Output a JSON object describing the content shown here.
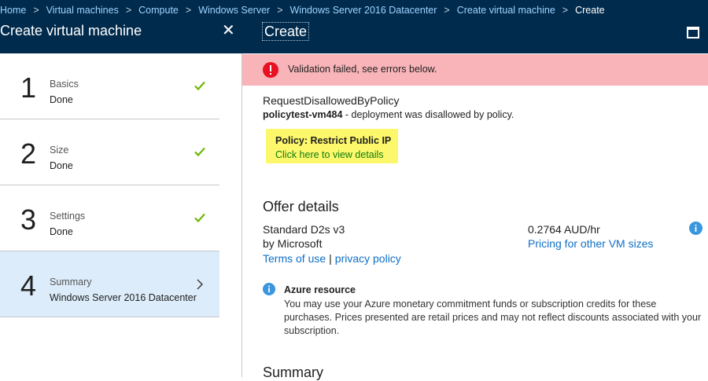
{
  "breadcrumb": [
    "Home",
    "Virtual machines",
    "Compute",
    "Windows Server",
    "Windows Server 2016 Datacenter",
    "Create virtual machine",
    "Create"
  ],
  "left_panel": {
    "title": "Create virtual machine",
    "close_icon": "close-icon",
    "steps": [
      {
        "number": "1",
        "label": "Basics",
        "status": "Done",
        "state": "complete"
      },
      {
        "number": "2",
        "label": "Size",
        "status": "Done",
        "state": "complete"
      },
      {
        "number": "3",
        "label": "Settings",
        "status": "Done",
        "state": "complete"
      },
      {
        "number": "4",
        "label": "Summary",
        "status": "Windows Server 2016 Datacenter",
        "state": "active"
      }
    ]
  },
  "right_panel": {
    "title": "Create",
    "maximize_icon": "maximize-icon",
    "alert": {
      "message": "Validation failed, see errors below.",
      "icon": "error-icon",
      "color": "#f8b4b8"
    },
    "error": {
      "code": "RequestDisallowedByPolicy",
      "resource": "policytest-vm484",
      "detail": " - deployment was disallowed by policy."
    },
    "policy": {
      "name": "Policy: Restrict Public IP",
      "link": "Click here to view details",
      "highlight": "#fcf76b"
    },
    "offer": {
      "title": "Offer details",
      "size": "Standard D2s v3",
      "publisher": "by Microsoft",
      "terms_link": "Terms of use",
      "separator": "|",
      "privacy_link": "privacy policy",
      "price": "0.2764 AUD/hr",
      "pricing_link": "Pricing for other VM sizes",
      "info_icon": "info-icon"
    },
    "azure_resource": {
      "title": "Azure resource",
      "body": "You may use your Azure monetary commitment funds or subscription credits for these purchases. Prices presented are retail prices and may not reflect discounts associated with your subscription."
    },
    "summary_title": "Summary"
  },
  "colors": {
    "header": "#002b4d",
    "active_step": "#dcecfa",
    "link": "#0f6fc6",
    "check": "#6bb700"
  }
}
